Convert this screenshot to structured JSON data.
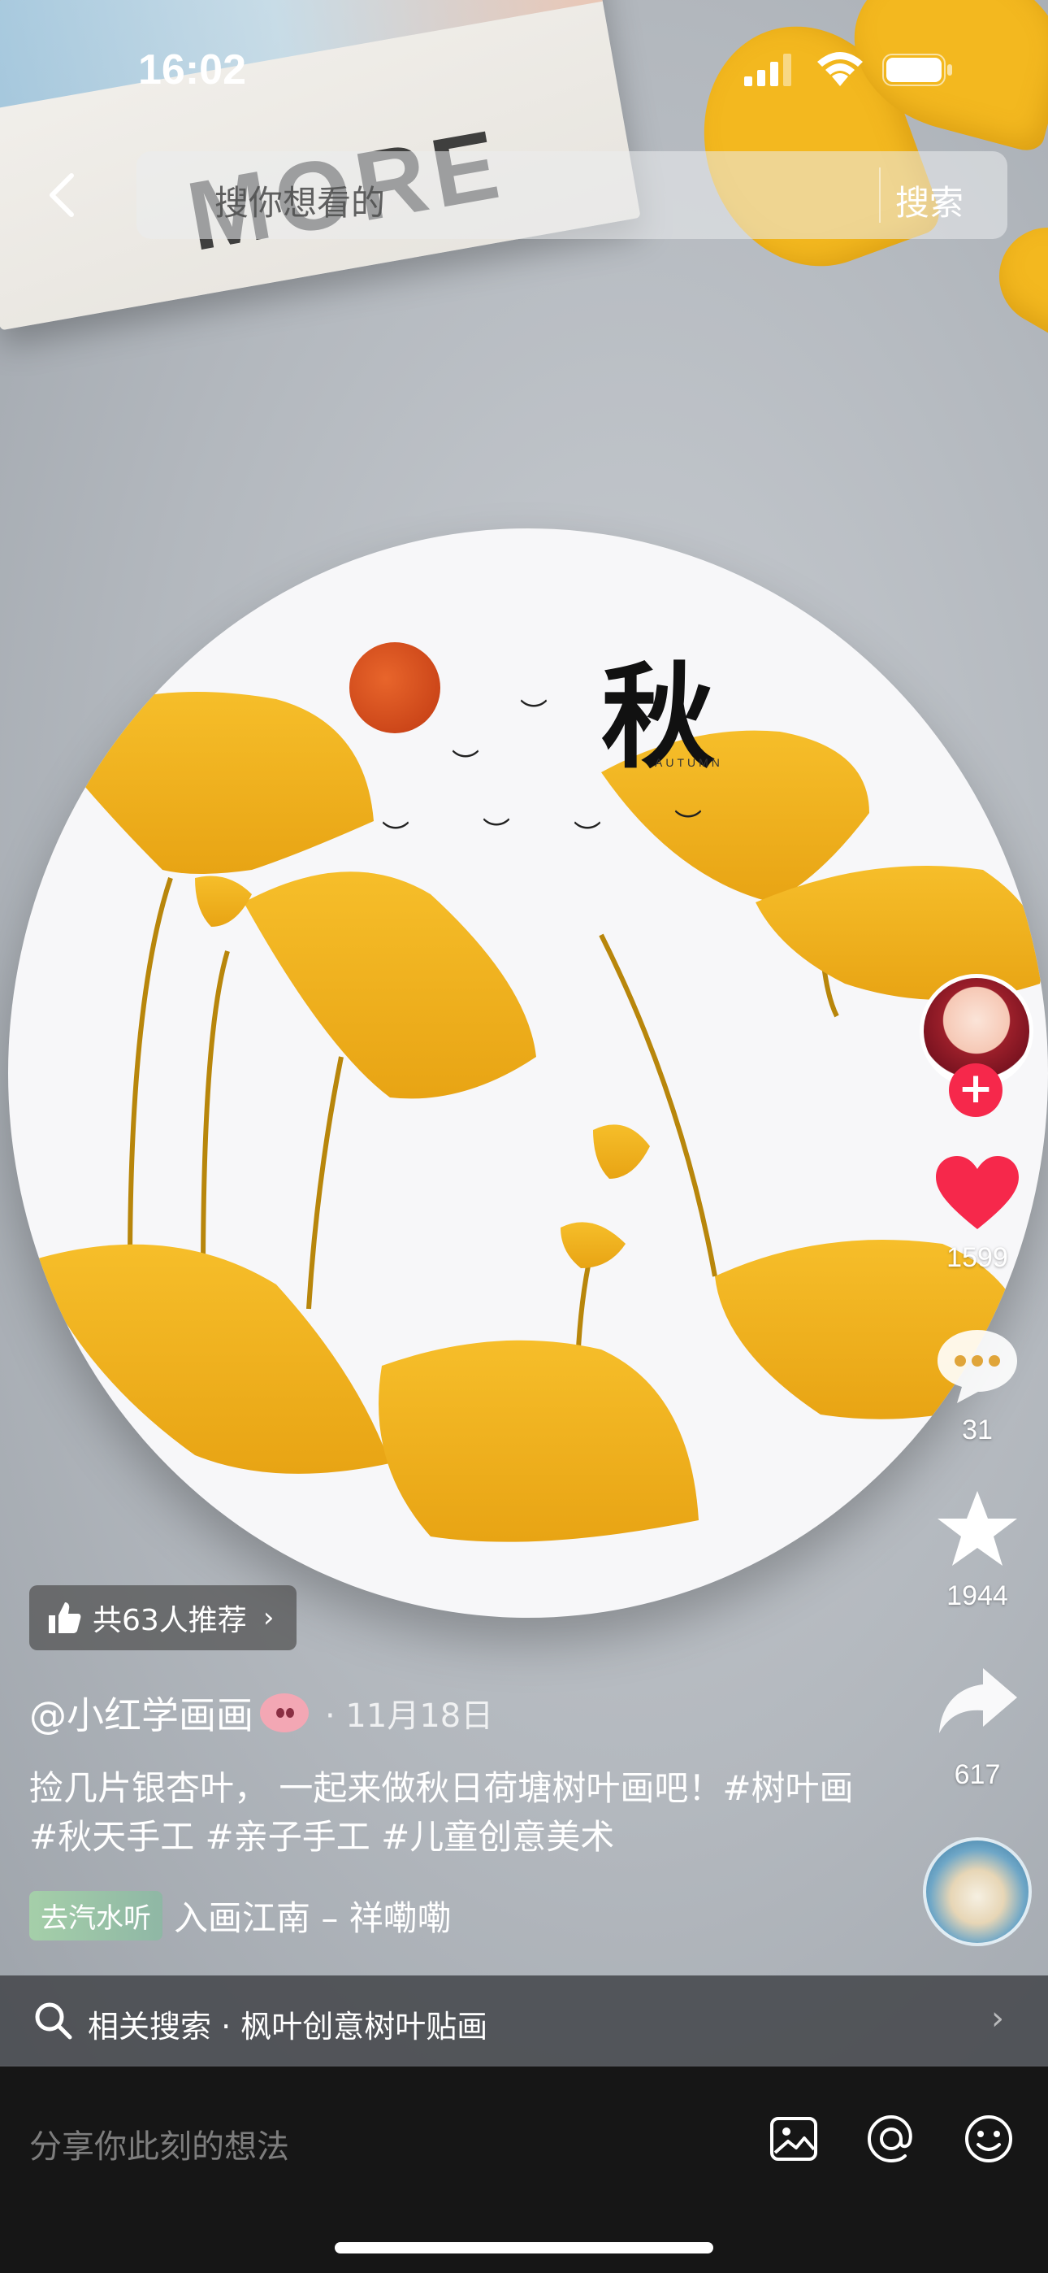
{
  "status_bar": {
    "time": "16:02"
  },
  "search": {
    "placeholder": "搜你想看的",
    "button": "搜索"
  },
  "artwork": {
    "title_char": "秋",
    "subtitle": "AUTUMN"
  },
  "actions": {
    "likes": "1599",
    "comments": "31",
    "favorites": "1944",
    "shares": "617",
    "follow": "+",
    "like_color": "#f6284b"
  },
  "post": {
    "recommend": "共63人推荐",
    "author": "@小红学画画",
    "date": "· 11月18日",
    "description": "捡几片银杏叶， 一起来做秋日荷塘树叶画吧！#树叶画 #秋天手工 #亲子手工 #儿童创意美术",
    "music_tag": "去汽水听",
    "music_name": "入画江南 – 祥嘞嘞"
  },
  "related_search": {
    "text": "相关搜索 · 枫叶创意树叶贴画"
  },
  "comment_bar": {
    "placeholder": "分享你此刻的想法"
  }
}
